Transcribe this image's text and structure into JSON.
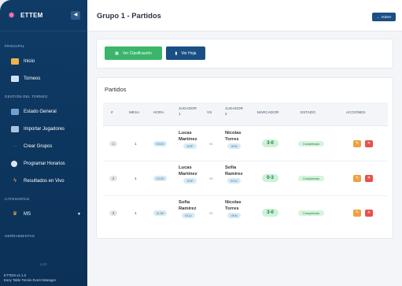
{
  "app": {
    "name": "ETTEM",
    "collapse_icon": "chevron-left-icon"
  },
  "sidebar": {
    "sections": [
      {
        "label": "PRINCIPAL"
      },
      {
        "label": "GESTIÓN DEL TORNEO"
      },
      {
        "label": "CATEGORÍAS"
      },
      {
        "label": "HERRAMIENTAS"
      }
    ],
    "items": [
      {
        "label": "Inicio",
        "icon": "home-icon"
      },
      {
        "label": "Torneos",
        "icon": "calendar-icon"
      },
      {
        "label": "Estado General",
        "icon": "bar-chart-icon"
      },
      {
        "label": "Importar Jugadores",
        "icon": "import-icon"
      },
      {
        "label": "Crear Grupos",
        "icon": "groups-icon"
      },
      {
        "label": "Programar Horarios",
        "icon": "clock-icon"
      },
      {
        "label": "Resultados en Vivo",
        "icon": "bolt-icon"
      },
      {
        "label": "MS",
        "icon": "trophy-icon"
      }
    ],
    "footer": {
      "dim": "1100",
      "version": "ETTEM v2.1.0",
      "subtitle": "Easy Table Tennis Event Manager"
    }
  },
  "header": {
    "title": "Grupo 1 - Partidos",
    "back_label": "← Volver"
  },
  "actions": {
    "ver_clasificacion": "Ver Clasificación",
    "ver_hoja": "Ver Hoja"
  },
  "partidos": {
    "title": "Partidos",
    "columns": {
      "num": "#",
      "mesa": "MESA",
      "hora": "HORA",
      "j1a": "JUGADOR",
      "j1b": "1",
      "vs": "VS",
      "j2a": "JUGADOR",
      "j2b": "2",
      "marcador": "MARCADOR",
      "estado": "ESTADO",
      "acciones": "ACCIONES"
    },
    "rows": [
      {
        "num": "1",
        "mesa": "1",
        "hora": "09:00",
        "p1a": "Lucas",
        "p1b": "Martínez",
        "c1": "ESP",
        "vs": "vs",
        "p2a": "Nicolas",
        "p2b": "Torres",
        "c2": "VEN",
        "score": "3-0",
        "estado": "Completado"
      },
      {
        "num": "2",
        "mesa": "1",
        "hora": "10:00",
        "p1a": "Lucas",
        "p1b": "Martínez",
        "c1": "ESP",
        "vs": "vs",
        "p2a": "Sofia",
        "p2b": "Ramirez",
        "c2": "ECU",
        "score": "0-3",
        "estado": "Completado"
      },
      {
        "num": "3",
        "mesa": "1",
        "hora": "11:00",
        "p1a": "Sofia",
        "p1b": "Ramirez",
        "c1": "ECU",
        "vs": "vs",
        "p2a": "Nicolas",
        "p2b": "Torres",
        "c2": "VEN",
        "score": "3-0",
        "estado": "Completado"
      }
    ]
  },
  "colors": {
    "sidebar": "#0f3b66",
    "primary": "#1a4f86",
    "success": "#3ab56a",
    "warning": "#f0a040",
    "danger": "#e8504a"
  }
}
